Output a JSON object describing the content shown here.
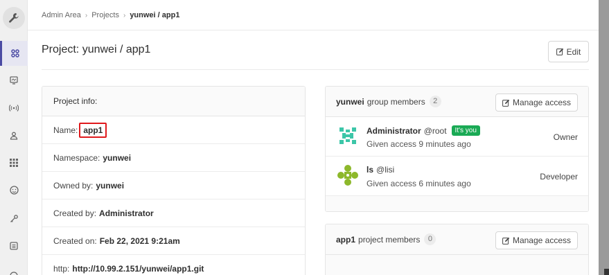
{
  "breadcrumb": {
    "items": [
      "Admin Area",
      "Projects"
    ],
    "current": "yunwei / app1"
  },
  "page": {
    "title": "Project: yunwei / app1",
    "edit_label": "Edit"
  },
  "project_info": {
    "header": "Project info:",
    "name_label": "Name:",
    "name_value": "app1",
    "namespace_label": "Namespace:",
    "namespace_value": "yunwei",
    "owned_by_label": "Owned by:",
    "owned_by_value": "yunwei",
    "created_by_label": "Created by:",
    "created_by_value": "Administrator",
    "created_on_label": "Created on:",
    "created_on_value": "Feb 22, 2021 9:21am",
    "http_label": "http:",
    "http_value": "http://10.99.2.151/yunwei/app1.git"
  },
  "group_members": {
    "group_name": "yunwei",
    "title_suffix": "group members",
    "count": "2",
    "manage_label": "Manage access",
    "members": [
      {
        "name": "Administrator",
        "username": "@root",
        "badge": "It's you",
        "access": "Given access 9 minutes ago",
        "role": "Owner"
      },
      {
        "name": "ls",
        "username": "@lisi",
        "badge": "",
        "access": "Given access 6 minutes ago",
        "role": "Developer"
      }
    ]
  },
  "project_members": {
    "project_name": "app1",
    "title_suffix": "project members",
    "count": "0",
    "manage_label": "Manage access"
  },
  "sidebar": {
    "items": [
      "overview-icon",
      "monitoring-icon",
      "messages-icon",
      "users-icon",
      "applications-icon",
      "abuse-reports-icon",
      "deploy-keys-icon",
      "labels-icon",
      "appearance-icon"
    ]
  },
  "colors": {
    "accent": "#4b4ba3",
    "highlight": "#e0191c",
    "badge_green": "#1aaa55"
  }
}
